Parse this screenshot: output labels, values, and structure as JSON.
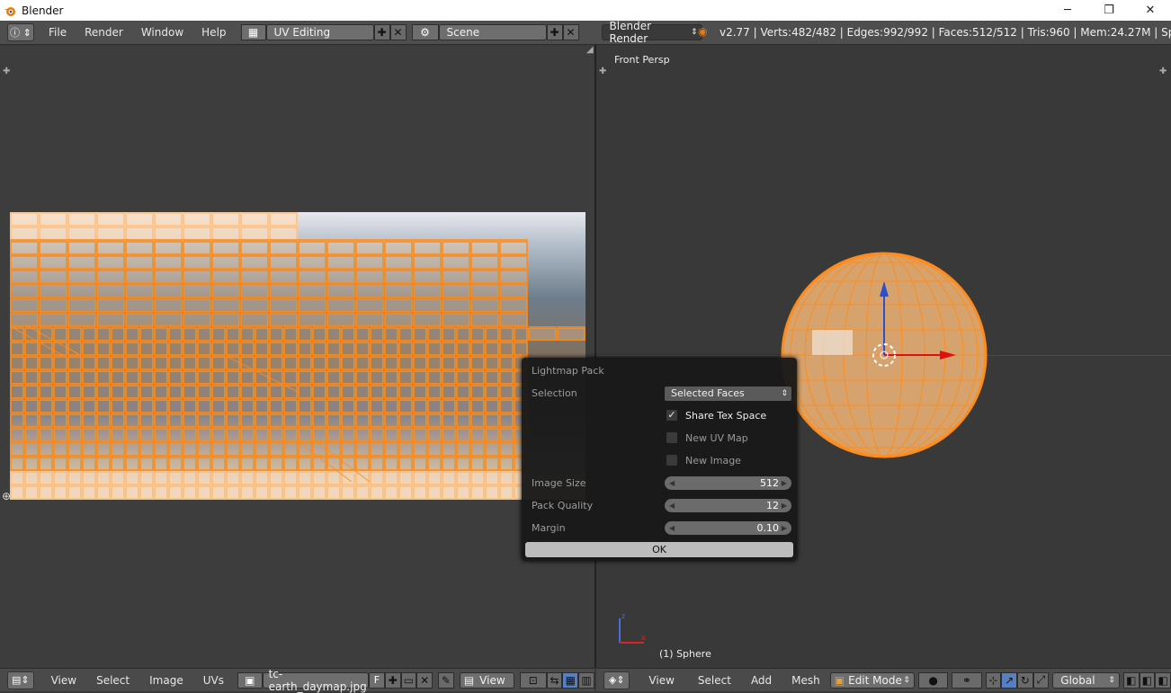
{
  "window": {
    "title": "Blender",
    "minimize": "─",
    "maximize": "❐",
    "close": "✕"
  },
  "infobar": {
    "menus": [
      "File",
      "Render",
      "Window",
      "Help"
    ],
    "screen_layout": "UV Editing",
    "scene": "Scene",
    "render_engine": "Blender Render",
    "stats": "v2.77 | Verts:482/482 | Edges:992/992 | Faces:512/512 | Tris:960 | Mem:24.27M | Sphere"
  },
  "uv_editor": {
    "menus": [
      "View",
      "Select",
      "Image",
      "UVs"
    ],
    "image_name": "tc-earth_daymap.jpg",
    "fake_user": "F",
    "view_menu": "View"
  },
  "viewport": {
    "label": "Front Persp",
    "object_label": "(1) Sphere",
    "menus": [
      "View",
      "Select",
      "Add",
      "Mesh"
    ],
    "mode": "Edit Mode",
    "orientation": "Global"
  },
  "dialog": {
    "title": "Lightmap Pack",
    "selection_label": "Selection",
    "selection_value": "Selected Faces",
    "share_tex_space": {
      "label": "Share Tex Space",
      "checked": true
    },
    "new_uv_map": {
      "label": "New UV Map",
      "checked": false
    },
    "new_image": {
      "label": "New Image",
      "checked": false
    },
    "image_size_label": "Image Size",
    "image_size": "512",
    "pack_quality_label": "Pack Quality",
    "pack_quality": "12",
    "margin_label": "Margin",
    "margin": "0.10",
    "ok": "OK"
  },
  "colors": {
    "uv_edge": "#ff8c1a",
    "selected_face": "#ffb060",
    "accent": "#5680c2"
  }
}
